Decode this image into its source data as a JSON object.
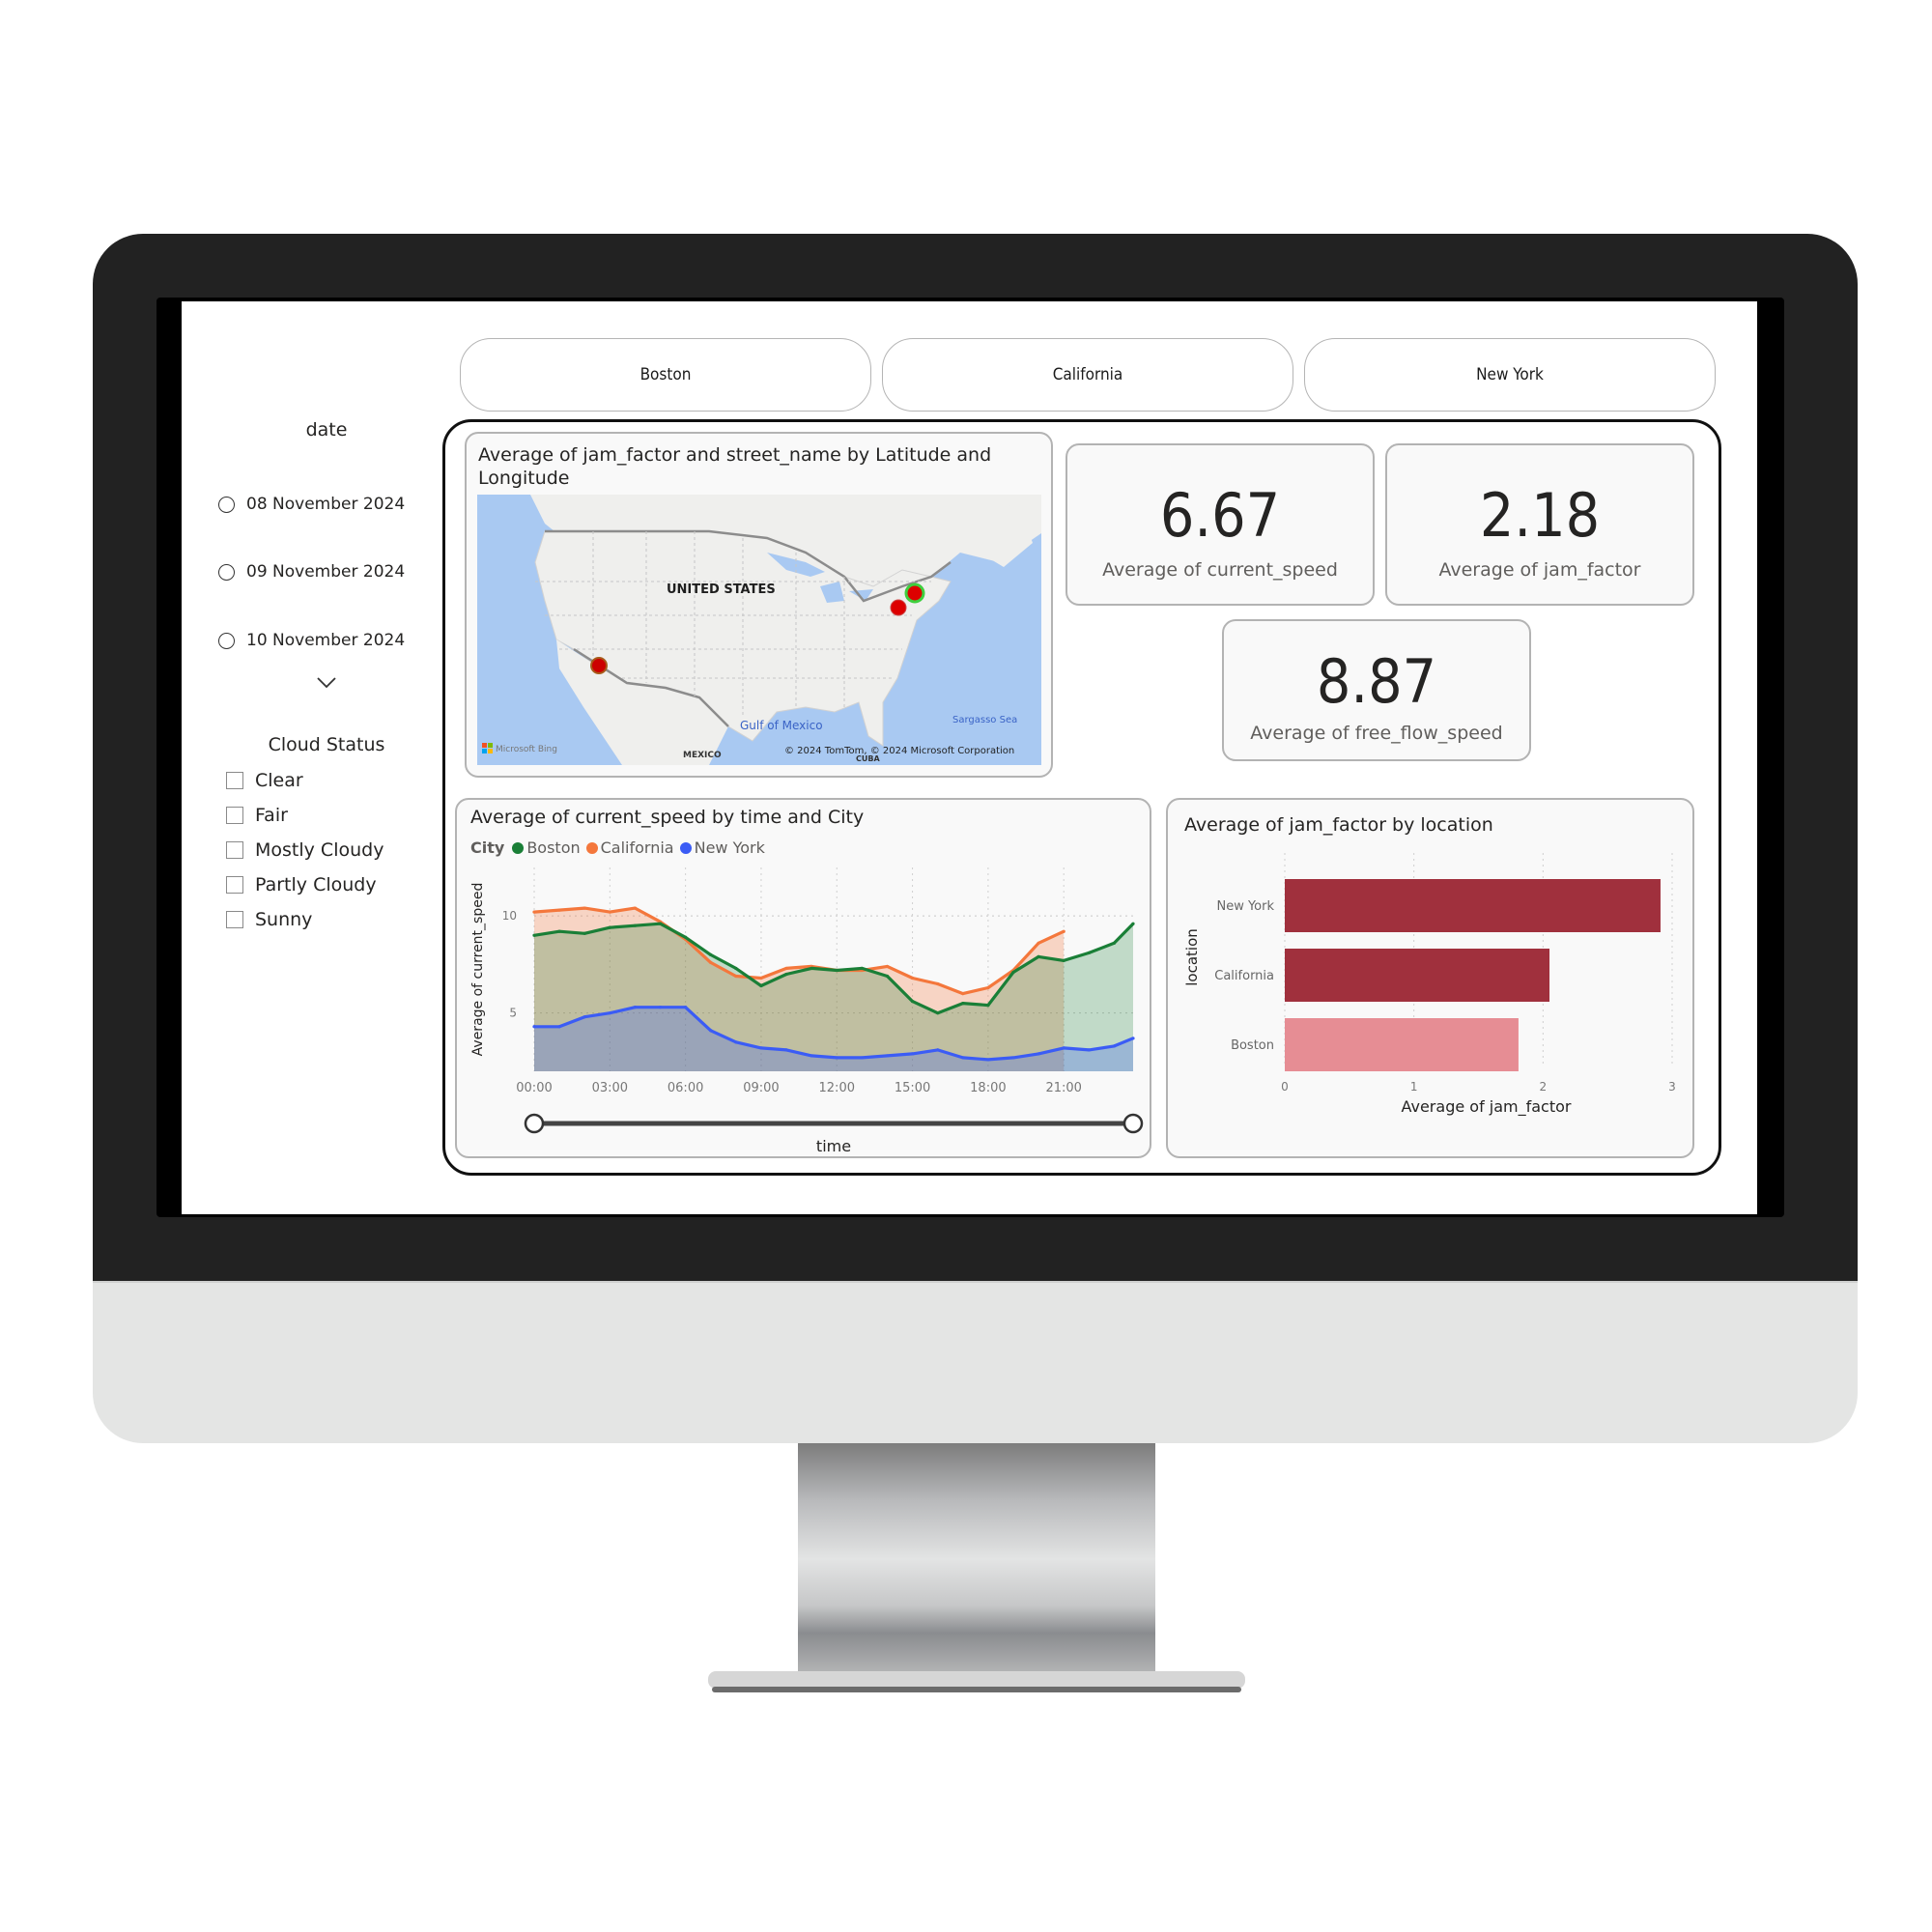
{
  "slicer_buttons": [
    "Boston",
    "California",
    "New York"
  ],
  "date_slicer": {
    "title": "date",
    "options": [
      "08 November 2024",
      "09 November 2024",
      "10 November 2024"
    ],
    "more_icon": "chevron-down-icon"
  },
  "cloud_slicer": {
    "title": "Cloud Status",
    "options": [
      "Clear",
      "Fair",
      "Mostly Cloudy",
      "Partly Cloudy",
      "Sunny"
    ]
  },
  "map_card": {
    "title": "Average of jam_factor and street_name by Latitude and Longitude",
    "labels": {
      "country": "UNITED STATES",
      "gulf": "Gulf of Mexico",
      "sea": "Sargasso Sea",
      "mexico": "MEXICO",
      "cuba": "CUBA",
      "attribution": "© 2024 TomTom, © 2024 Microsoft Corporation",
      "brand": "Microsoft Bing"
    },
    "points": [
      {
        "name": "California",
        "highlight": false
      },
      {
        "name": "New York",
        "highlight": false
      },
      {
        "name": "Boston",
        "highlight": true
      }
    ]
  },
  "kpis": [
    {
      "value": "6.67",
      "label": "Average of current_speed"
    },
    {
      "value": "2.18",
      "label": "Average of jam_factor"
    },
    {
      "value": "8.87",
      "label": "Average of free_flow_speed"
    }
  ],
  "colors": {
    "boston": "#1a7f37",
    "california": "#f4773c",
    "new_york": "#3b5cf5",
    "bar_dark": "#a0303d",
    "bar_light": "#e68d94"
  },
  "chart_data": [
    {
      "type": "area",
      "title": "Average of current_speed by time and City",
      "legend_title": "City",
      "legend_position": "top-left",
      "xlabel": "time",
      "ylabel": "Average of current_speed",
      "x_ticks": [
        "00:00",
        "03:00",
        "06:00",
        "09:00",
        "12:00",
        "15:00",
        "18:00",
        "21:00"
      ],
      "y_ticks": [
        5,
        10
      ],
      "xlim_hours": [
        0,
        23.75
      ],
      "ylim": [
        2,
        11.5
      ],
      "grid": true,
      "x_hours": [
        0,
        1,
        2,
        3,
        4,
        5,
        6,
        7,
        8,
        9,
        10,
        11,
        12,
        13,
        14,
        15,
        16,
        17,
        18,
        19,
        20,
        21,
        22,
        23,
        23.75
      ],
      "series": [
        {
          "name": "Boston",
          "values": [
            9.0,
            9.2,
            9.1,
            9.4,
            9.5,
            9.6,
            8.9,
            8.0,
            7.3,
            6.4,
            7.0,
            7.3,
            7.2,
            7.3,
            6.9,
            5.6,
            5.0,
            5.5,
            5.4,
            7.1,
            7.9,
            7.7,
            8.1,
            8.6,
            9.6
          ]
        },
        {
          "name": "California",
          "values": [
            10.2,
            10.3,
            10.4,
            10.2,
            10.4,
            9.7,
            8.8,
            7.6,
            6.9,
            6.8,
            7.3,
            7.4,
            7.2,
            7.2,
            7.4,
            6.8,
            6.5,
            6.0,
            6.3,
            7.2,
            8.6,
            9.2,
            null,
            null,
            null
          ]
        },
        {
          "name": "New York",
          "values": [
            4.3,
            4.3,
            4.8,
            5.0,
            5.3,
            5.3,
            5.3,
            4.1,
            3.5,
            3.2,
            3.1,
            2.8,
            2.7,
            2.7,
            2.8,
            2.9,
            3.1,
            2.7,
            2.6,
            2.7,
            2.9,
            3.2,
            3.1,
            3.3,
            3.7
          ]
        }
      ],
      "slider": {
        "range_start": "00:00",
        "range_end": "23:45"
      }
    },
    {
      "type": "bar",
      "orientation": "horizontal",
      "title": "Average of jam_factor by location",
      "xlabel": "Average of jam_factor",
      "ylabel": "location",
      "categories": [
        "New York",
        "California",
        "Boston"
      ],
      "values": [
        2.91,
        2.05,
        1.81
      ],
      "x_ticks": [
        0,
        1,
        2,
        3
      ],
      "xlim": [
        0,
        3
      ],
      "grid": true
    }
  ]
}
